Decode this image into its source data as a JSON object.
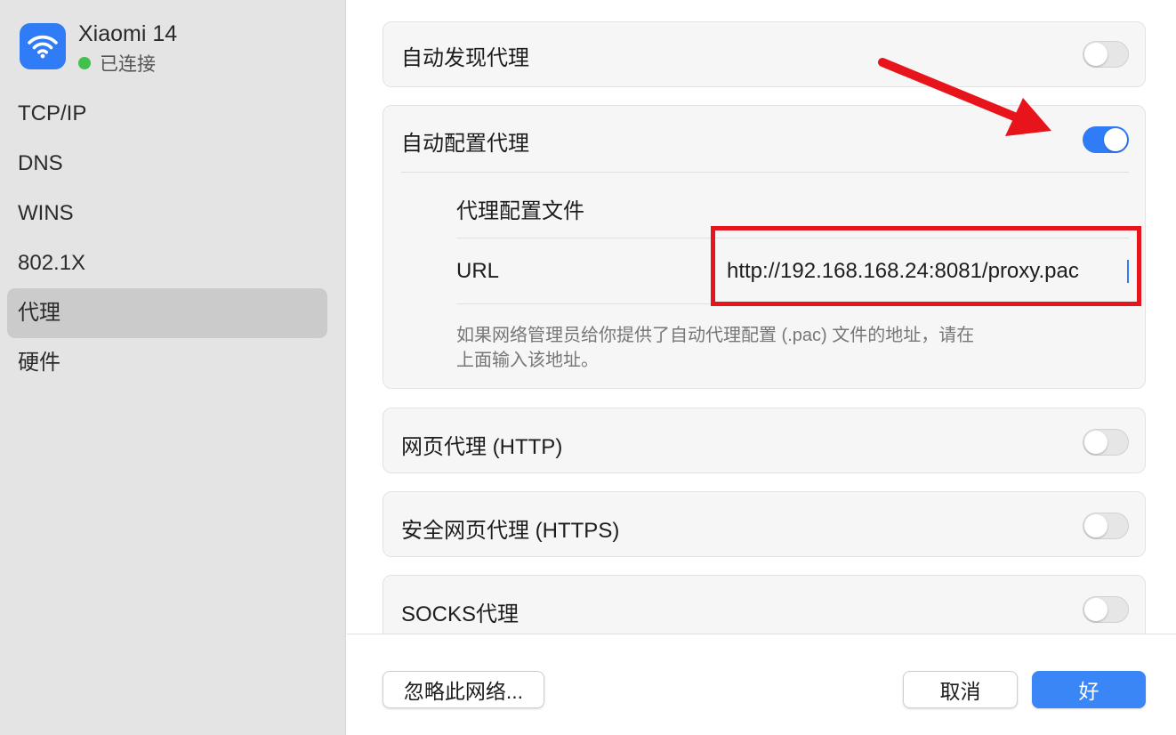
{
  "network": {
    "name": "Xiaomi 14",
    "status": "已连接",
    "icon": "wifi-icon",
    "status_color": "#3fc14b"
  },
  "sidebar": {
    "items": [
      {
        "label": "TCP/IP",
        "active": false
      },
      {
        "label": "DNS",
        "active": false
      },
      {
        "label": "WINS",
        "active": false
      },
      {
        "label": "802.1X",
        "active": false
      },
      {
        "label": "代理",
        "active": true
      },
      {
        "label": "硬件",
        "active": false
      }
    ]
  },
  "proxies": {
    "auto_discovery": {
      "label": "自动发现代理",
      "enabled": false
    },
    "auto_config": {
      "label": "自动配置代理",
      "enabled": true,
      "config_file_label": "代理配置文件",
      "url_label": "URL",
      "url_value": "http://192.168.168.24:8081/proxy.pac",
      "help_line1": "如果网络管理员给你提供了自动代理配置 (.pac) 文件的地址，请在",
      "help_line2": "上面输入该地址。"
    },
    "http": {
      "label": "网页代理 (HTTP)",
      "enabled": false
    },
    "https": {
      "label": "安全网页代理 (HTTPS)",
      "enabled": false
    },
    "socks": {
      "label": "SOCKS代理",
      "enabled": false
    }
  },
  "footer": {
    "forget_label": "忽略此网络...",
    "cancel_label": "取消",
    "ok_label": "好"
  },
  "colors": {
    "accent": "#2f7cf6",
    "annotation": "#e8141b",
    "sidebar_bg": "#e4e4e4"
  }
}
